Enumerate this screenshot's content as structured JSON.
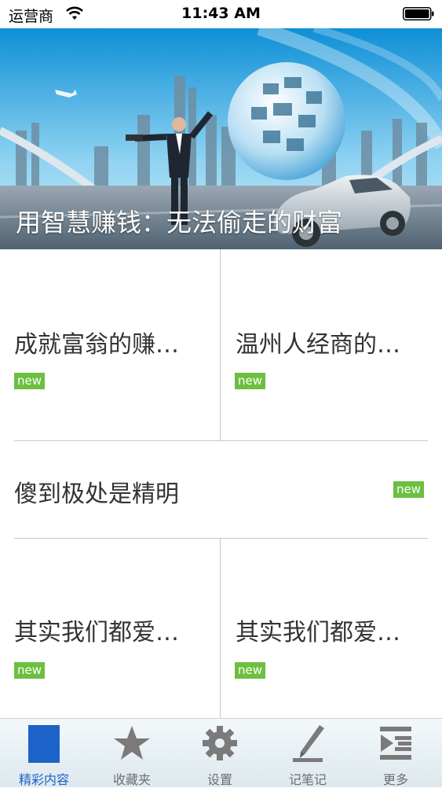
{
  "status_bar": {
    "carrier": "运营商",
    "time": "11:43 AM"
  },
  "banner": {
    "title": "用智慧赚钱：无法偷走的财富"
  },
  "articles": [
    {
      "title": "成就富翁的赚…",
      "badge": "new"
    },
    {
      "title": "温州人经商的…",
      "badge": "new"
    },
    {
      "title": "傻到极处是精明",
      "badge": "new"
    },
    {
      "title": "其实我们都爱…",
      "badge": "new"
    },
    {
      "title": "其实我们都爱…",
      "badge": "new"
    }
  ],
  "tabs": [
    {
      "label": "精彩内容",
      "icon": "content-icon",
      "active": true
    },
    {
      "label": "收藏夹",
      "icon": "star-icon",
      "active": false
    },
    {
      "label": "设置",
      "icon": "gear-icon",
      "active": false
    },
    {
      "label": "记笔记",
      "icon": "pen-icon",
      "active": false
    },
    {
      "label": "更多",
      "icon": "more-icon",
      "active": false
    }
  ],
  "colors": {
    "badge": "#6cbf3f",
    "active_tab": "#1c63c9",
    "inactive_tab": "#6f6f6f"
  }
}
